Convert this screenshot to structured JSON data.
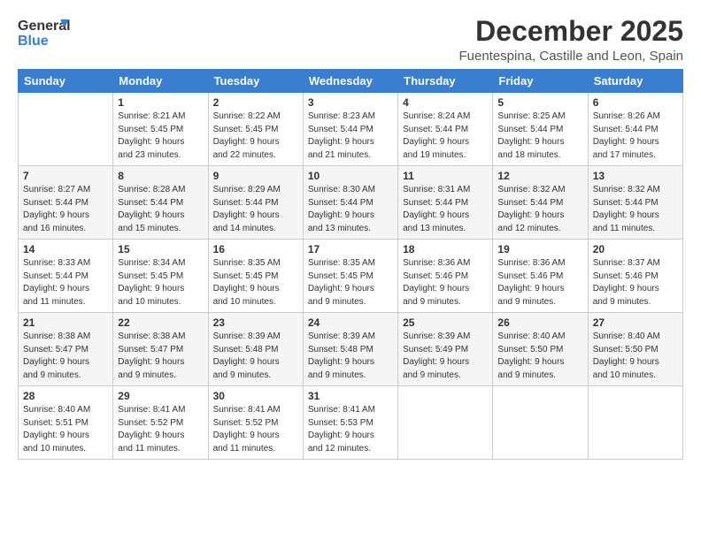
{
  "header": {
    "logo_line1": "General",
    "logo_line2": "Blue",
    "title": "December 2025",
    "subtitle": "Fuentespina, Castille and Leon, Spain"
  },
  "calendar": {
    "days_of_week": [
      "Sunday",
      "Monday",
      "Tuesday",
      "Wednesday",
      "Thursday",
      "Friday",
      "Saturday"
    ],
    "weeks": [
      [
        {
          "day": "",
          "details": ""
        },
        {
          "day": "1",
          "details": "Sunrise: 8:21 AM\nSunset: 5:45 PM\nDaylight: 9 hours\nand 23 minutes."
        },
        {
          "day": "2",
          "details": "Sunrise: 8:22 AM\nSunset: 5:45 PM\nDaylight: 9 hours\nand 22 minutes."
        },
        {
          "day": "3",
          "details": "Sunrise: 8:23 AM\nSunset: 5:44 PM\nDaylight: 9 hours\nand 21 minutes."
        },
        {
          "day": "4",
          "details": "Sunrise: 8:24 AM\nSunset: 5:44 PM\nDaylight: 9 hours\nand 19 minutes."
        },
        {
          "day": "5",
          "details": "Sunrise: 8:25 AM\nSunset: 5:44 PM\nDaylight: 9 hours\nand 18 minutes."
        },
        {
          "day": "6",
          "details": "Sunrise: 8:26 AM\nSunset: 5:44 PM\nDaylight: 9 hours\nand 17 minutes."
        }
      ],
      [
        {
          "day": "7",
          "details": "Sunrise: 8:27 AM\nSunset: 5:44 PM\nDaylight: 9 hours\nand 16 minutes."
        },
        {
          "day": "8",
          "details": "Sunrise: 8:28 AM\nSunset: 5:44 PM\nDaylight: 9 hours\nand 15 minutes."
        },
        {
          "day": "9",
          "details": "Sunrise: 8:29 AM\nSunset: 5:44 PM\nDaylight: 9 hours\nand 14 minutes."
        },
        {
          "day": "10",
          "details": "Sunrise: 8:30 AM\nSunset: 5:44 PM\nDaylight: 9 hours\nand 13 minutes."
        },
        {
          "day": "11",
          "details": "Sunrise: 8:31 AM\nSunset: 5:44 PM\nDaylight: 9 hours\nand 13 minutes."
        },
        {
          "day": "12",
          "details": "Sunrise: 8:32 AM\nSunset: 5:44 PM\nDaylight: 9 hours\nand 12 minutes."
        },
        {
          "day": "13",
          "details": "Sunrise: 8:32 AM\nSunset: 5:44 PM\nDaylight: 9 hours\nand 11 minutes."
        }
      ],
      [
        {
          "day": "14",
          "details": "Sunrise: 8:33 AM\nSunset: 5:44 PM\nDaylight: 9 hours\nand 11 minutes."
        },
        {
          "day": "15",
          "details": "Sunrise: 8:34 AM\nSunset: 5:45 PM\nDaylight: 9 hours\nand 10 minutes."
        },
        {
          "day": "16",
          "details": "Sunrise: 8:35 AM\nSunset: 5:45 PM\nDaylight: 9 hours\nand 10 minutes."
        },
        {
          "day": "17",
          "details": "Sunrise: 8:35 AM\nSunset: 5:45 PM\nDaylight: 9 hours\nand 9 minutes."
        },
        {
          "day": "18",
          "details": "Sunrise: 8:36 AM\nSunset: 5:46 PM\nDaylight: 9 hours\nand 9 minutes."
        },
        {
          "day": "19",
          "details": "Sunrise: 8:36 AM\nSunset: 5:46 PM\nDaylight: 9 hours\nand 9 minutes."
        },
        {
          "day": "20",
          "details": "Sunrise: 8:37 AM\nSunset: 5:46 PM\nDaylight: 9 hours\nand 9 minutes."
        }
      ],
      [
        {
          "day": "21",
          "details": "Sunrise: 8:38 AM\nSunset: 5:47 PM\nDaylight: 9 hours\nand 9 minutes."
        },
        {
          "day": "22",
          "details": "Sunrise: 8:38 AM\nSunset: 5:47 PM\nDaylight: 9 hours\nand 9 minutes."
        },
        {
          "day": "23",
          "details": "Sunrise: 8:39 AM\nSunset: 5:48 PM\nDaylight: 9 hours\nand 9 minutes."
        },
        {
          "day": "24",
          "details": "Sunrise: 8:39 AM\nSunset: 5:48 PM\nDaylight: 9 hours\nand 9 minutes."
        },
        {
          "day": "25",
          "details": "Sunrise: 8:39 AM\nSunset: 5:49 PM\nDaylight: 9 hours\nand 9 minutes."
        },
        {
          "day": "26",
          "details": "Sunrise: 8:40 AM\nSunset: 5:50 PM\nDaylight: 9 hours\nand 9 minutes."
        },
        {
          "day": "27",
          "details": "Sunrise: 8:40 AM\nSunset: 5:50 PM\nDaylight: 9 hours\nand 10 minutes."
        }
      ],
      [
        {
          "day": "28",
          "details": "Sunrise: 8:40 AM\nSunset: 5:51 PM\nDaylight: 9 hours\nand 10 minutes."
        },
        {
          "day": "29",
          "details": "Sunrise: 8:41 AM\nSunset: 5:52 PM\nDaylight: 9 hours\nand 11 minutes."
        },
        {
          "day": "30",
          "details": "Sunrise: 8:41 AM\nSunset: 5:52 PM\nDaylight: 9 hours\nand 11 minutes."
        },
        {
          "day": "31",
          "details": "Sunrise: 8:41 AM\nSunset: 5:53 PM\nDaylight: 9 hours\nand 12 minutes."
        },
        {
          "day": "",
          "details": ""
        },
        {
          "day": "",
          "details": ""
        },
        {
          "day": "",
          "details": ""
        }
      ]
    ]
  }
}
